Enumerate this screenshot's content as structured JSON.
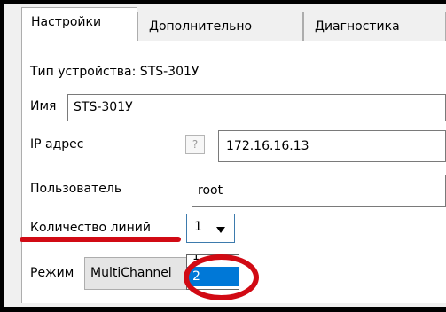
{
  "tabs": [
    {
      "label": "Настройки"
    },
    {
      "label": "Дополнительно"
    },
    {
      "label": "Диагностика"
    }
  ],
  "form": {
    "device_type": "Тип устройства: STS-301У",
    "name_label": "Имя",
    "name_value": "STS-301У",
    "ip_label": "IP адрес",
    "ip_help": "?",
    "ip_value": "172.16.16.13",
    "user_label": "Пользователь",
    "user_value": "root",
    "lines_label": "Количество линий",
    "lines_value": "1",
    "lines_options": [
      "1",
      "2"
    ],
    "mode_label": "Режим",
    "mode_value": "MultiChannel"
  },
  "colors": {
    "annotation": "#d10a14",
    "selection": "#0078d7"
  }
}
